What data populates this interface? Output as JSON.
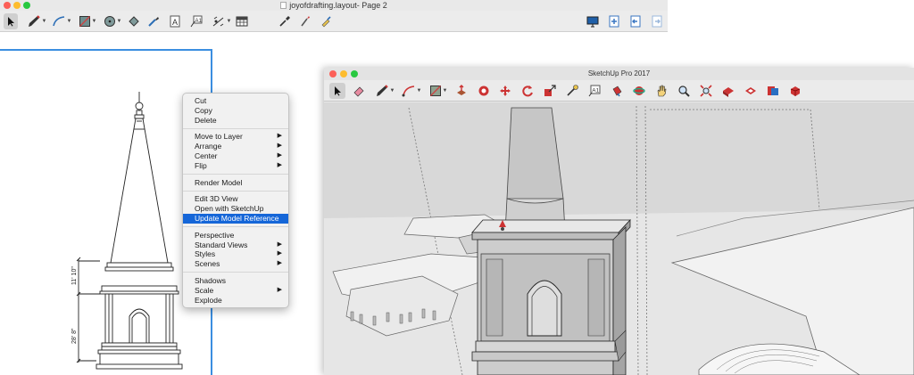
{
  "layout_window": {
    "title": "joyofdrafting.layout- Page 2",
    "traffic_colors": [
      "#fc5f57",
      "#fdbc2e",
      "#28c840"
    ]
  },
  "drawing": {
    "dim_upper": "11' 10\"",
    "dim_lower": "28' 8\""
  },
  "context_menu": {
    "groups": [
      [
        {
          "label": "Cut"
        },
        {
          "label": "Copy"
        },
        {
          "label": "Delete"
        }
      ],
      [
        {
          "label": "Move to Layer",
          "submenu": true
        },
        {
          "label": "Arrange",
          "submenu": true
        },
        {
          "label": "Center",
          "submenu": true
        },
        {
          "label": "Flip",
          "submenu": true
        }
      ],
      [
        {
          "label": "Render Model"
        }
      ],
      [
        {
          "label": "Edit 3D View"
        },
        {
          "label": "Open with SketchUp"
        },
        {
          "label": "Update Model Reference",
          "highlighted": true
        }
      ],
      [
        {
          "label": "Perspective"
        },
        {
          "label": "Standard Views",
          "submenu": true
        },
        {
          "label": "Styles",
          "submenu": true
        },
        {
          "label": "Scenes",
          "submenu": true
        }
      ],
      [
        {
          "label": "Shadows"
        },
        {
          "label": "Scale",
          "submenu": true
        },
        {
          "label": "Explode"
        }
      ]
    ],
    "highlight_color": "#1566d8",
    "arrow_glyph": "▶"
  },
  "sketchup_window": {
    "title": "SketchUp Pro 2017"
  },
  "layout_toolbar_icons": [
    "select-tool",
    "pencil-tool",
    "arc-tool",
    "rectangle-tool",
    "circle-tool",
    "offset-tool",
    "eraser-style-tool",
    "text-tool",
    "label-tool",
    "dimension-tool",
    "table-tool",
    "eyedropper-tool",
    "split-tool",
    "paint-tool",
    "presentation-tool",
    "add-page-tool",
    "previous-page-tool",
    "next-page-tool"
  ],
  "sketchup_toolbar_icons": [
    "select-tool",
    "eraser-tool",
    "pencil-tool",
    "arc-tool",
    "shapes-tool",
    "push-pull-tool",
    "offset-tool",
    "move-tool",
    "rotate-tool",
    "scale-tool",
    "tape-measure-tool",
    "text-tool",
    "paint-bucket-tool",
    "orbit-tool",
    "pan-tool",
    "zoom-tool",
    "zoom-extents-tool",
    "warehouse-tool",
    "extension-warehouse-tool",
    "send-to-layout-tool",
    "extension-manager-tool"
  ]
}
